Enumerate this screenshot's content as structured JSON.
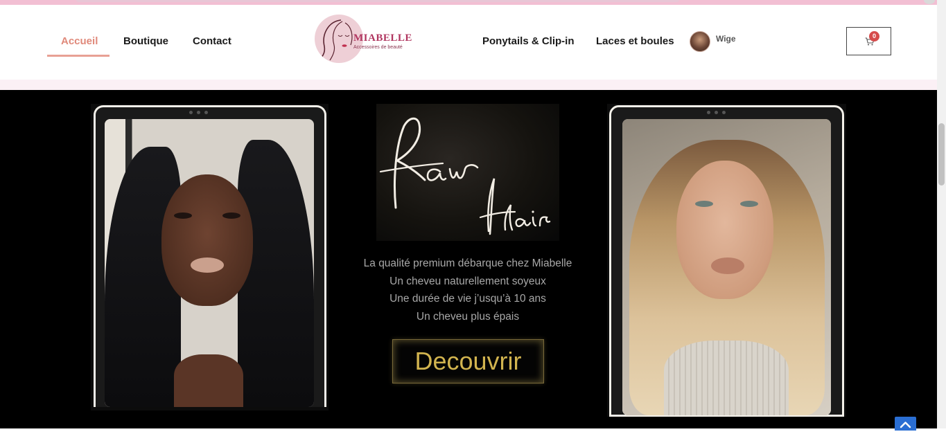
{
  "nav": {
    "left": [
      {
        "label": "Accueil",
        "active": true
      },
      {
        "label": "Boutique",
        "active": false
      },
      {
        "label": "Contact",
        "active": false
      }
    ],
    "right": [
      {
        "label": "Ponytails & Clip-in"
      },
      {
        "label": "Laces et boules"
      }
    ]
  },
  "logo": {
    "brand": "MIABELLE",
    "tagline": "Accessoires de beauté"
  },
  "user": {
    "name": "Wige"
  },
  "cart": {
    "count": "0",
    "icon": "cart-icon"
  },
  "hero": {
    "title_word1": "Raw",
    "title_word2": "Hair",
    "lines": [
      "La qualité premium débarque chez Miabelle",
      "Un cheveu naturellement soyeux",
      "Une durée de vie j’usqu’à 10 ans",
      "Un cheveu plus épais"
    ],
    "cta_label": "Decouvrir"
  },
  "colors": {
    "accent": "#e0897a",
    "brand": "#b0355f",
    "cta_text": "#d2b44f",
    "hero_bg": "#000000",
    "back_to_top": "#2a6ed3"
  }
}
